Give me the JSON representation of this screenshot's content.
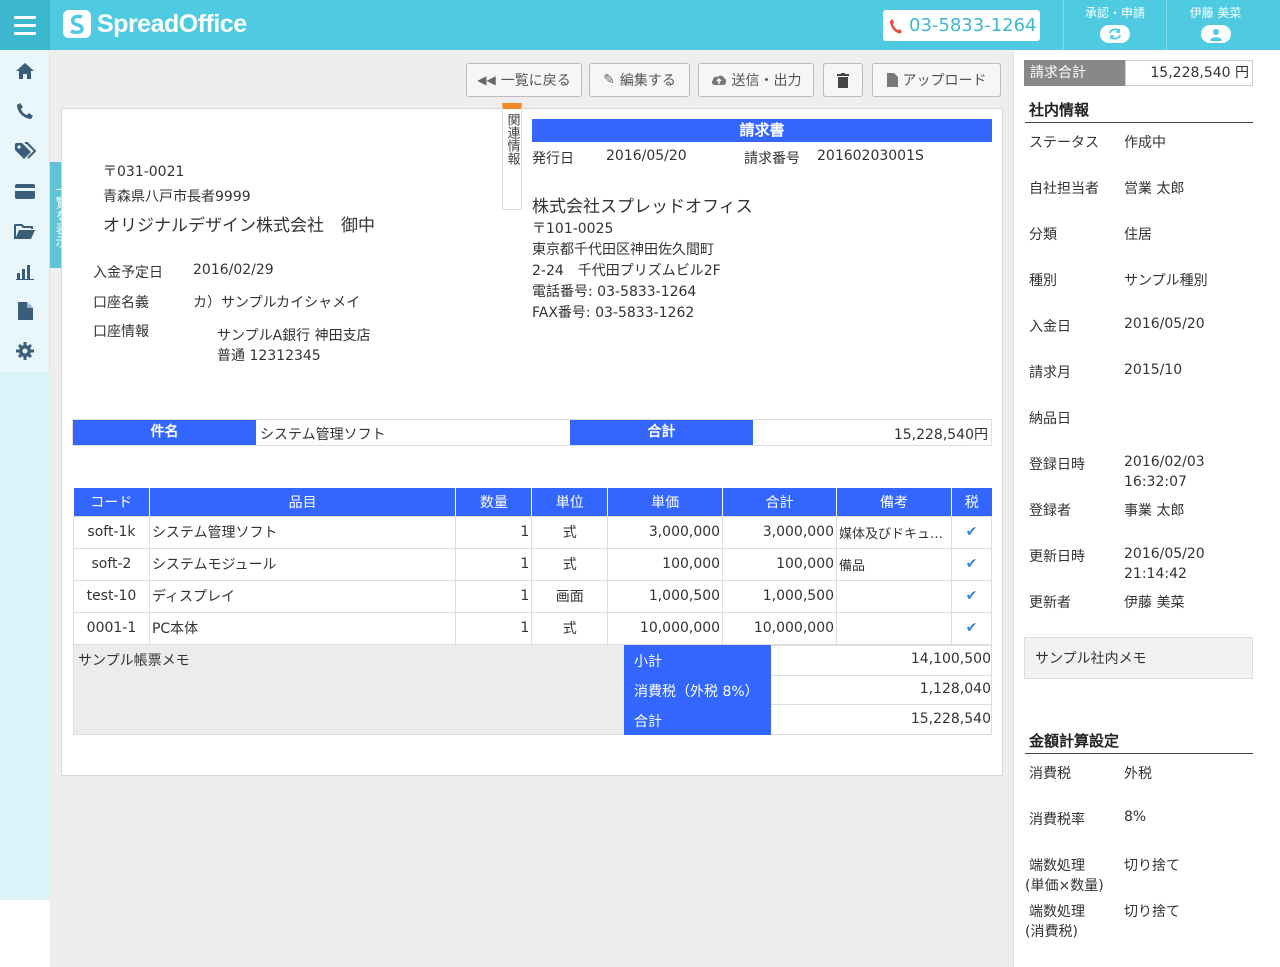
{
  "header": {
    "brand": "SpreadOffice",
    "phone": "03-5833-1264",
    "approval_label": "承認・申請",
    "user_name": "伊藤 美菜"
  },
  "sidebar": {
    "show_list_label": "一覧を表示",
    "icons": [
      "home-icon",
      "phone-icon",
      "tags-icon",
      "card-icon",
      "folder-icon",
      "chart-icon",
      "file-icon",
      "gear-icon"
    ]
  },
  "toolbar": {
    "back": "一覧に戻る",
    "edit": "編集する",
    "send": "送信・出力",
    "upload": "アップロード"
  },
  "related_tab": "関連情報",
  "doc": {
    "title": "請求書",
    "issue_date_label": "発行日",
    "issue_date": "2016/05/20",
    "invoice_no_label": "請求番号",
    "invoice_no": "20160203001S",
    "to_zip": "〒031-0021",
    "to_address": "青森県八戸市長者9999",
    "to_name": "オリジナルデザイン株式会社　御中",
    "from_company": "株式会社スプレッドオフィス",
    "from_zip": "〒101-0025",
    "from_addr1": "東京都千代田区神田佐久間町",
    "from_addr2": "2-24　千代田プリズムビル2F",
    "from_tel": "電話番号:  03-5833-1264",
    "from_fax": "FAX番号:  03-5833-1262",
    "payment_date_label": "入金予定日",
    "payment_date": "2016/02/29",
    "account_name_label": "口座名義",
    "account_name": "カ）サンプルカイシャメイ",
    "account_info_label": "口座情報",
    "account_bank": "サンプルA銀行 神田支店",
    "account_no": "普通 12312345",
    "subject_label": "件名",
    "subject": "システム管理ソフト",
    "total_label": "合計",
    "total": "15,228,540円",
    "columns": [
      "コード",
      "品目",
      "数量",
      "単位",
      "単価",
      "合計",
      "備考",
      "税"
    ],
    "rows": [
      {
        "code": "soft-1k",
        "name": "システム管理ソフト",
        "qty": "1",
        "unit": "式",
        "price": "3,000,000",
        "amount": "3,000,000",
        "note": "媒体及びドキュ…",
        "tax": "✔"
      },
      {
        "code": "soft-2",
        "name": "システムモジュール",
        "qty": "1",
        "unit": "式",
        "price": "100,000",
        "amount": "100,000",
        "note": "備品",
        "tax": "✔"
      },
      {
        "code": "test-10",
        "name": "ディスプレイ",
        "qty": "1",
        "unit": "画面",
        "price": "1,000,500",
        "amount": "1,000,500",
        "note": "",
        "tax": "✔"
      },
      {
        "code": "0001-1",
        "name": "PC本体",
        "qty": "1",
        "unit": "式",
        "price": "10,000,000",
        "amount": "10,000,000",
        "note": "",
        "tax": "✔"
      }
    ],
    "memo": "サンプル帳票メモ",
    "subtotal_label": "小計",
    "subtotal": "14,100,500",
    "tax_label": "消費税（外税 8%）",
    "tax": "1,128,040",
    "grand_label": "合計",
    "grand": "15,228,540"
  },
  "right": {
    "invoice_total_label": "請求合計",
    "invoice_total": "15,228,540 円",
    "internal_heading": "社内情報",
    "fields": [
      {
        "label": "ステータス",
        "value": "作成中"
      },
      {
        "label": "自社担当者",
        "value": "営業 太郎"
      },
      {
        "label": "分類",
        "value": "住居"
      },
      {
        "label": "種別",
        "value": "サンプル種別"
      },
      {
        "label": "入金日",
        "value": "2016/05/20"
      },
      {
        "label": "請求月",
        "value": "2015/10"
      },
      {
        "label": "納品日",
        "value": ""
      },
      {
        "label": "登録日時",
        "value": "2016/02/03",
        "value2": "16:32:07"
      },
      {
        "label": "登録者",
        "value": "事業 太郎"
      },
      {
        "label": "更新日時",
        "value": "2016/05/20",
        "value2": "21:14:42"
      },
      {
        "label": "更新者",
        "value": "伊藤 美菜"
      }
    ],
    "memo": "サンプル社内メモ",
    "calc_heading": "金額計算設定",
    "calc": [
      {
        "label": "消費税",
        "value": "外税"
      },
      {
        "label": "消費税率",
        "value": "8%"
      },
      {
        "label": "端数処理",
        "label2": "(単価×数量)",
        "value": "切り捨て"
      },
      {
        "label": "端数処理",
        "label2": "(消費税)",
        "value": "切り捨て"
      }
    ]
  }
}
